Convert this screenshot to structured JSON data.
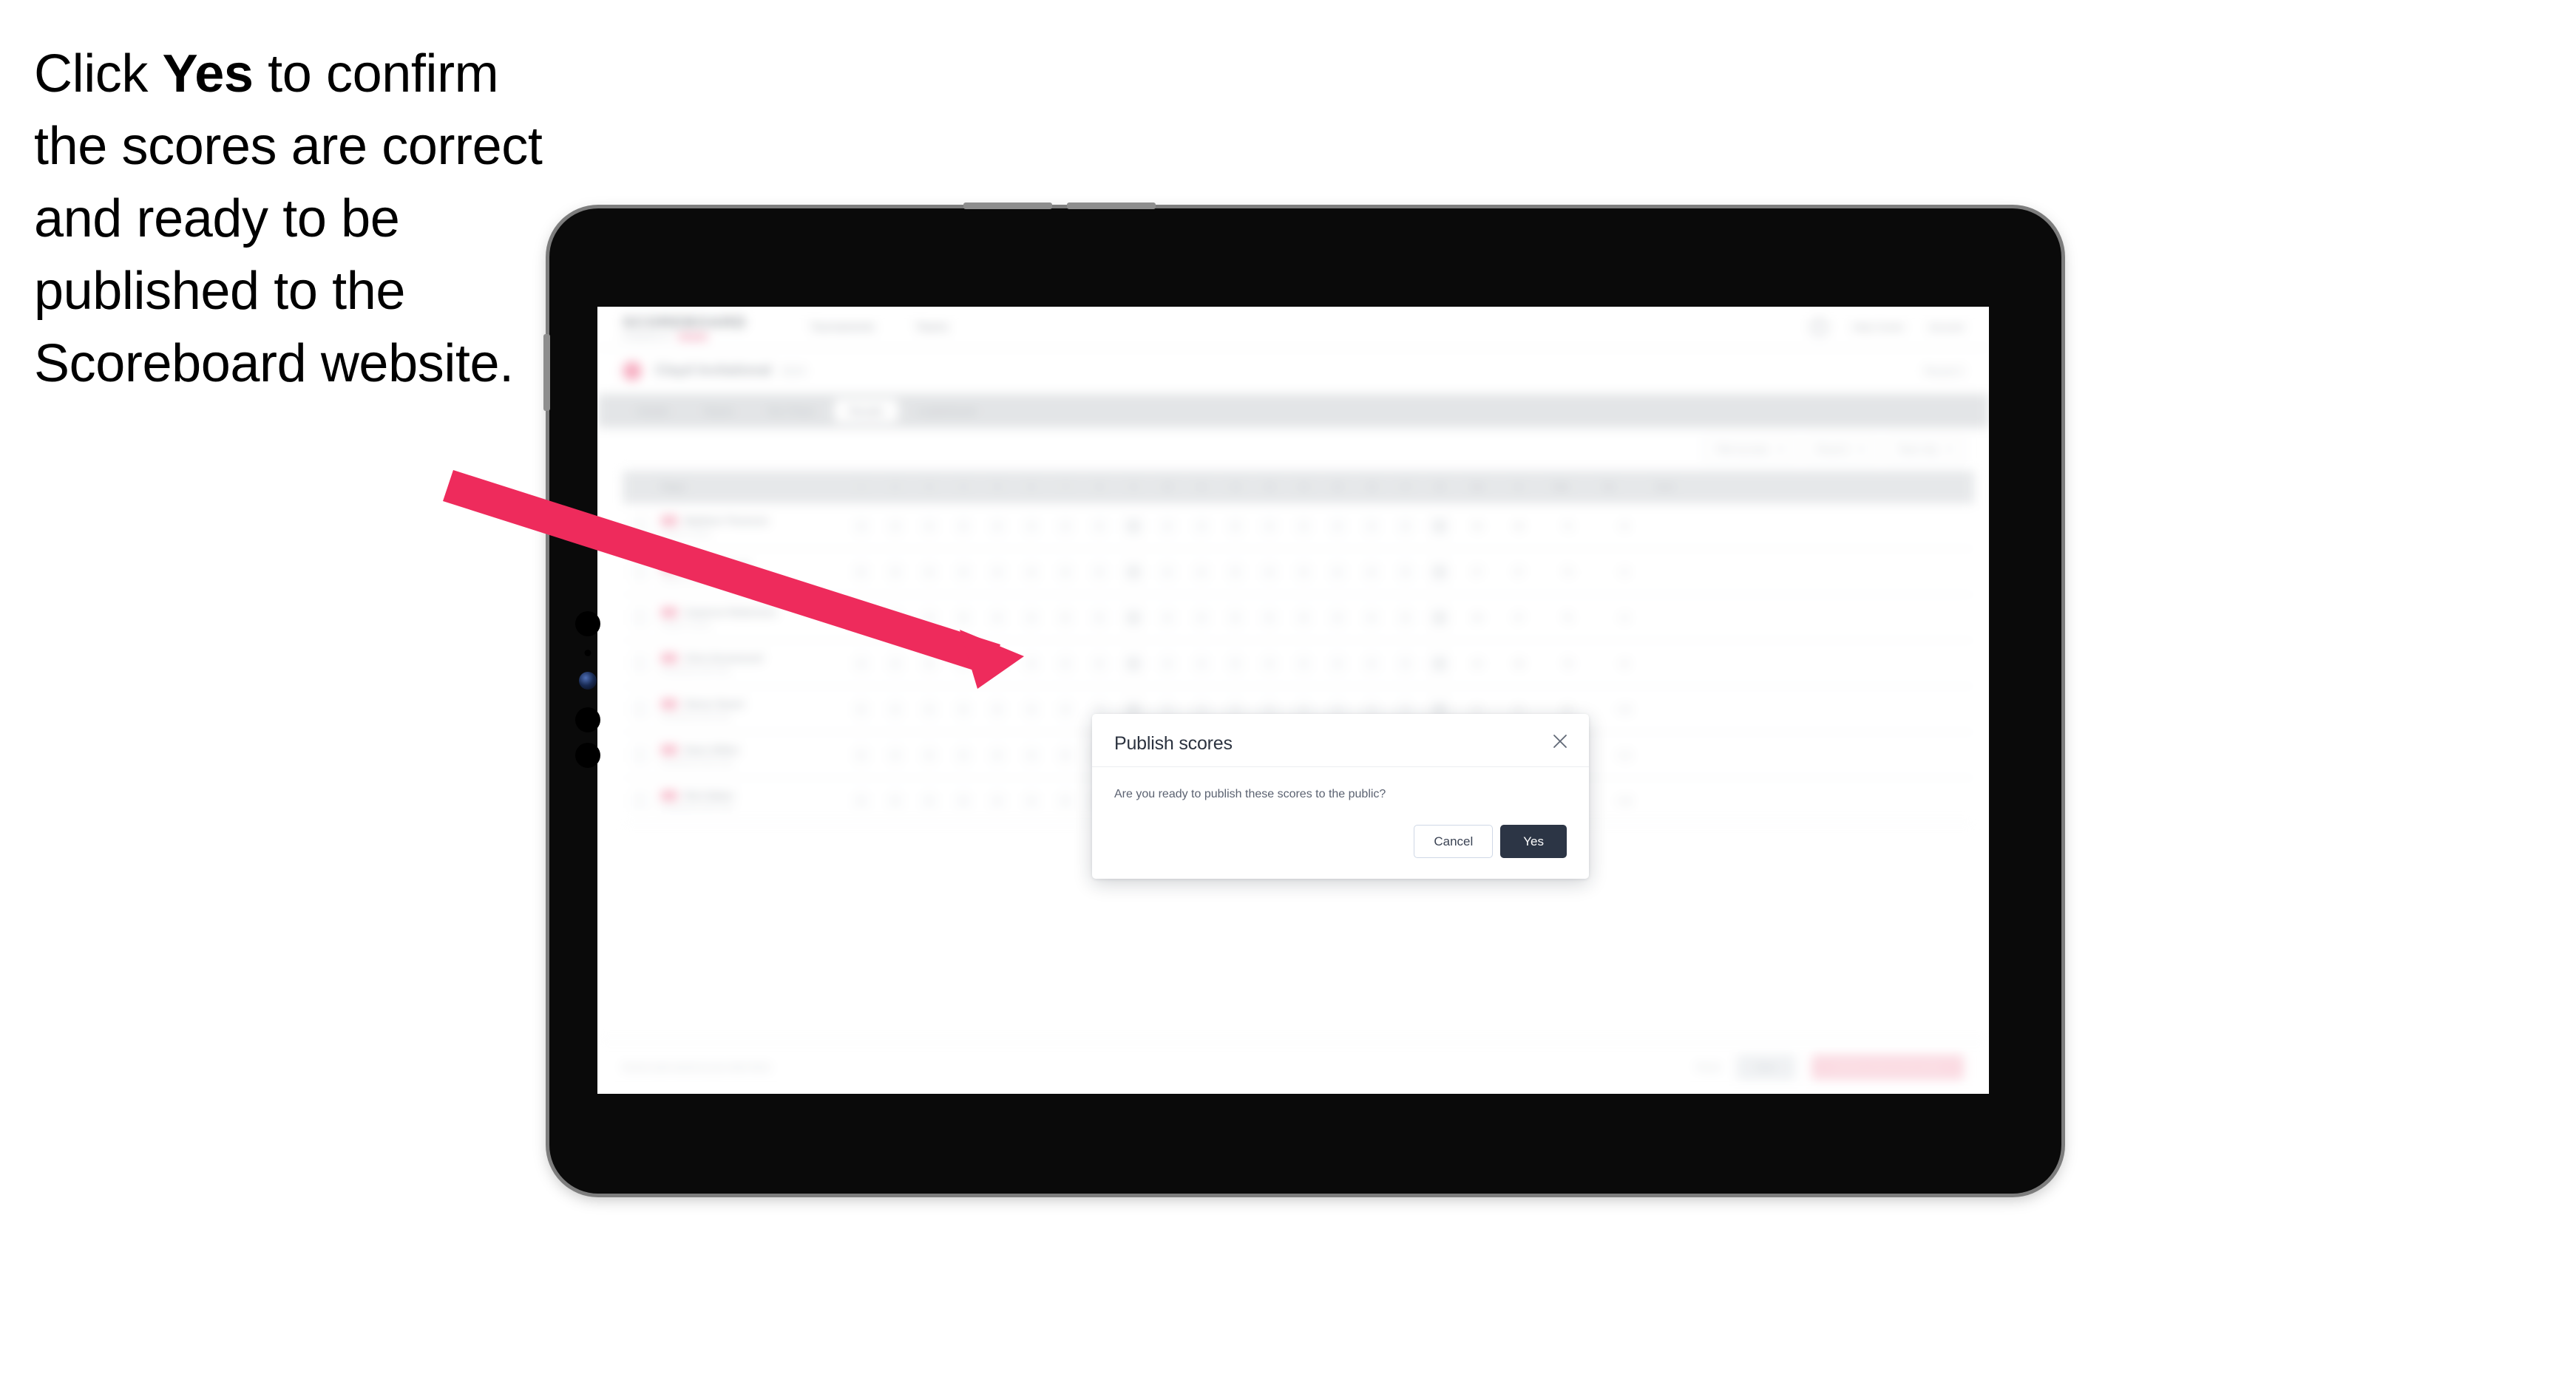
{
  "caption": {
    "before": "Click ",
    "emphasis": "Yes",
    "after": " to confirm the scores are correct and ready to be published to the Scoreboard website."
  },
  "colors": {
    "arrow": "#EE2B5C",
    "dialog_primary": "#2C3545",
    "dialog_cancel_border": "#CFD8E6",
    "brand_pink": "#F2819F",
    "device_body": "#0A0A0A",
    "device_frame": "#7D7D7D",
    "tab_bar": "#D3D6D9",
    "table_header": "#D8DBDE"
  },
  "annotation": {
    "arrow_name": "pointer-arrow",
    "from": [
      615,
      640
    ],
    "to": [
      1390,
      888
    ]
  },
  "device": {
    "type": "tablet",
    "orientation": "landscape"
  },
  "app": {
    "header": {
      "logo": "SCOREBOARD",
      "tagline": "POWERED BY",
      "nav": [
        "Tournaments",
        "Teams"
      ],
      "right_links": [
        "Help Centre",
        "Account"
      ],
      "notification_icon": "bell-icon"
    },
    "event": {
      "title": "Clayd Invitational",
      "subtitle": "2024",
      "right_label": "Round 2"
    },
    "tabs": [
      {
        "label": "Details",
        "active": false
      },
      {
        "label": "Teams",
        "active": false
      },
      {
        "label": "Tee Times",
        "active": false
      },
      {
        "label": "Results",
        "active": true
      },
      {
        "label": "Leaderboard",
        "active": false
      }
    ],
    "filters": [
      {
        "label": "Filter by team",
        "icon": "chevron-down-icon"
      },
      {
        "label": "Round 2",
        "icon": "chevron-down-icon"
      },
      {
        "label": "Team only",
        "icon": "chevron-down-icon"
      }
    ],
    "table": {
      "player_header": "Player",
      "hole_headers": [
        "1",
        "2",
        "3",
        "4",
        "5",
        "6",
        "7",
        "8",
        "9",
        "10",
        "11",
        "12",
        "13",
        "14",
        "15",
        "16",
        "17",
        "18"
      ],
      "summary_headers": [
        "Out",
        "In",
        "Total"
      ],
      "extra_headers": [
        "Par",
        "Score"
      ],
      "rows": [
        {
          "name": "Matthew Thomson",
          "club": "Clayd's Cricket",
          "scores": [
            "4",
            "3",
            "4",
            "5",
            "4",
            "3",
            "4",
            "5",
            "4",
            "4",
            "3",
            "5",
            "4",
            "4",
            "3",
            "4",
            "5",
            "4"
          ],
          "out": "36",
          "in": "36",
          "total": "72",
          "score": "+0"
        },
        {
          "name": "Oliver Pennell",
          "club": "Clayd's Cricket",
          "scores": [
            "5",
            "3",
            "4",
            "4",
            "4",
            "4",
            "4",
            "5",
            "4",
            "4",
            "4",
            "5",
            "4",
            "3",
            "4",
            "4",
            "5",
            "4"
          ],
          "out": "37",
          "in": "37",
          "total": "74",
          "score": "+2"
        },
        {
          "name": "Cameron Robertson",
          "club": "Clayd's Cricket",
          "scores": [
            "4",
            "4",
            "4",
            "5",
            "4",
            "3",
            "5",
            "5",
            "4",
            "4",
            "3",
            "5",
            "5",
            "4",
            "3",
            "4",
            "5",
            "4"
          ],
          "out": "38",
          "in": "37",
          "total": "75",
          "score": "+3"
        },
        {
          "name": "Chris Drummond",
          "club": "Northwood Golf Club",
          "scores": [
            "4",
            "4",
            "5",
            "5",
            "4",
            "4",
            "4",
            "5",
            "5",
            "4",
            "4",
            "5",
            "4",
            "4",
            "4",
            "4",
            "5",
            "4"
          ],
          "out": "40",
          "in": "38",
          "total": "78",
          "score": "+6"
        },
        {
          "name": "Simon Stuart",
          "club": "Northwood Golf Club",
          "scores": [
            "5",
            "4",
            "4",
            "5",
            "5",
            "4",
            "4",
            "6",
            "4",
            "5",
            "4",
            "5",
            "5",
            "4",
            "4",
            "4",
            "5",
            "5"
          ],
          "out": "41",
          "in": "41",
          "total": "82",
          "score": "+10"
        },
        {
          "name": "Dean Gillies",
          "club": "Southwood Golf Links",
          "scores": [
            "5",
            "4",
            "5",
            "5",
            "4",
            "4",
            "5",
            "5",
            "5",
            "5",
            "4",
            "5",
            "5",
            "4",
            "4",
            "5",
            "5",
            "5"
          ],
          "out": "42",
          "in": "42",
          "total": "84",
          "score": "+12"
        },
        {
          "name": "Rich Baker",
          "club": "Southwood Golf Links",
          "scores": [
            "5",
            "5",
            "5",
            "6",
            "4",
            "4",
            "5",
            "6",
            "5",
            "5",
            "5",
            "5",
            "5",
            "5",
            "4",
            "5",
            "6",
            "5"
          ],
          "out": "45",
          "in": "45",
          "total": "90",
          "score": "+18"
        }
      ]
    },
    "footer": {
      "note": "Scores auto-saved as you enter them",
      "link": "Reset",
      "secondary_button": "Save",
      "primary_button": "Publish scores to the public"
    }
  },
  "dialog": {
    "title": "Publish scores",
    "message": "Are you ready to publish these scores to the public?",
    "cancel_label": "Cancel",
    "confirm_label": "Yes",
    "close_icon": "close-icon"
  }
}
